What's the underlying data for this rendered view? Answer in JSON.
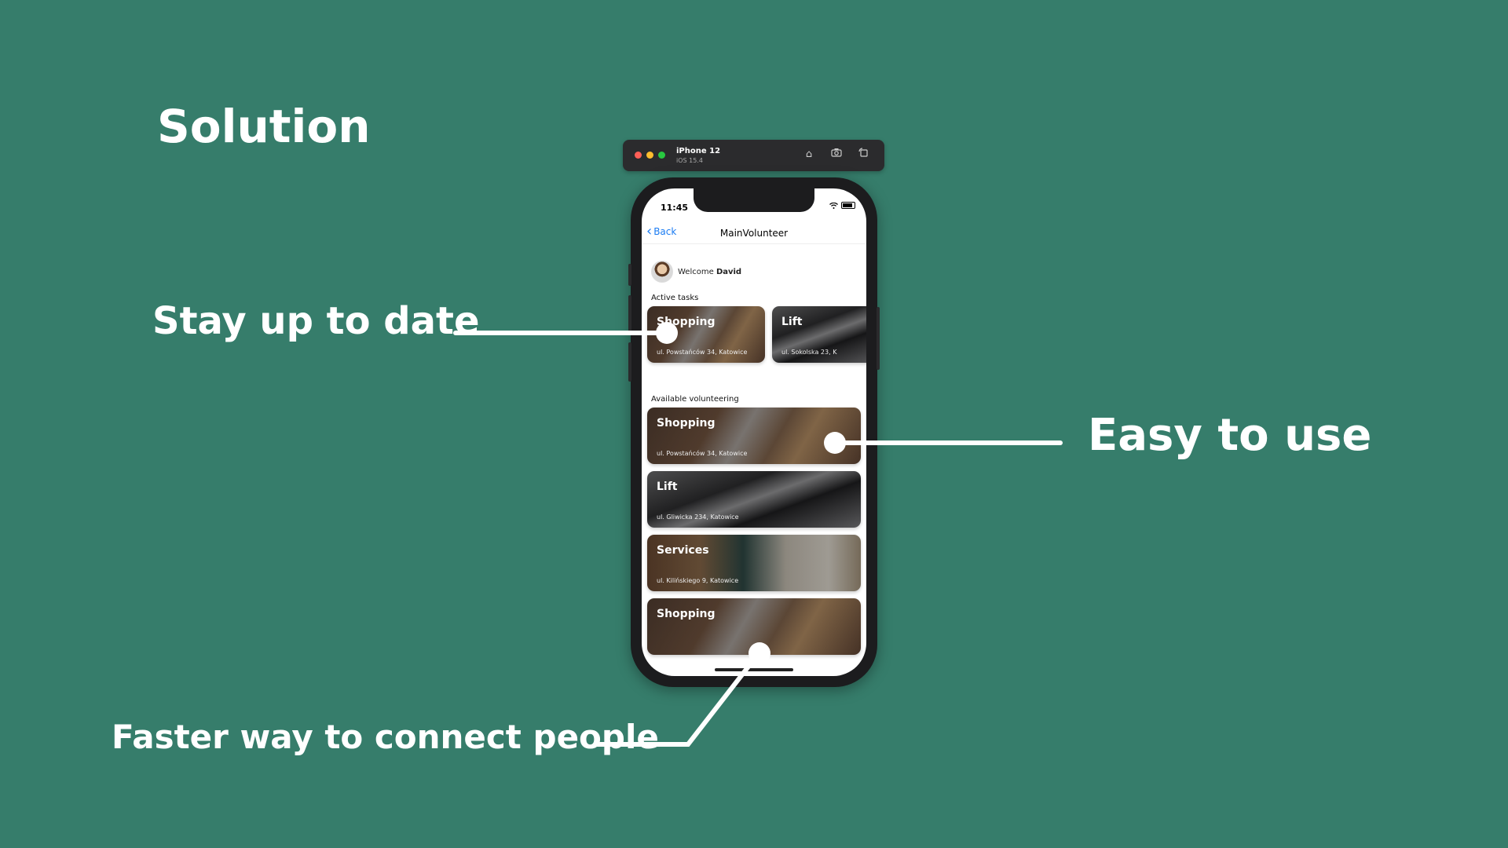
{
  "slide": {
    "title": "Solution",
    "callouts": {
      "stay_up_to_date": "Stay up to date",
      "easy_to_use": "Easy to use",
      "faster_way": "Faster way to connect people"
    }
  },
  "simulator": {
    "device_name": "iPhone 12",
    "os_version": "iOS 15.4",
    "buttons": [
      "home-icon",
      "screenshot-icon",
      "rotate-icon"
    ]
  },
  "app": {
    "status_bar": {
      "time": "11:45"
    },
    "nav": {
      "back_label": "Back",
      "title": "MainVolunteer"
    },
    "welcome": {
      "prefix": "Welcome",
      "name": "David"
    },
    "active_tasks": {
      "label": "Active tasks",
      "items": [
        {
          "title": "Shopping",
          "address": "ul. Powstańców 34, Katowice"
        },
        {
          "title": "Lift",
          "address": "ul. Sokolska 23, K"
        }
      ]
    },
    "available": {
      "label": "Available volunteering",
      "items": [
        {
          "title": "Shopping",
          "address": "ul. Powstańców 34, Katowice"
        },
        {
          "title": "Lift",
          "address": "ul. Gliwicka 234, Katowice"
        },
        {
          "title": "Services",
          "address": "ul. Kilińskiego 9, Katowice"
        },
        {
          "title": "Shopping",
          "address": ""
        }
      ]
    }
  },
  "colors": {
    "background": "#367d6b",
    "link": "#1a7bf2",
    "callout_line": "#ffffff"
  }
}
